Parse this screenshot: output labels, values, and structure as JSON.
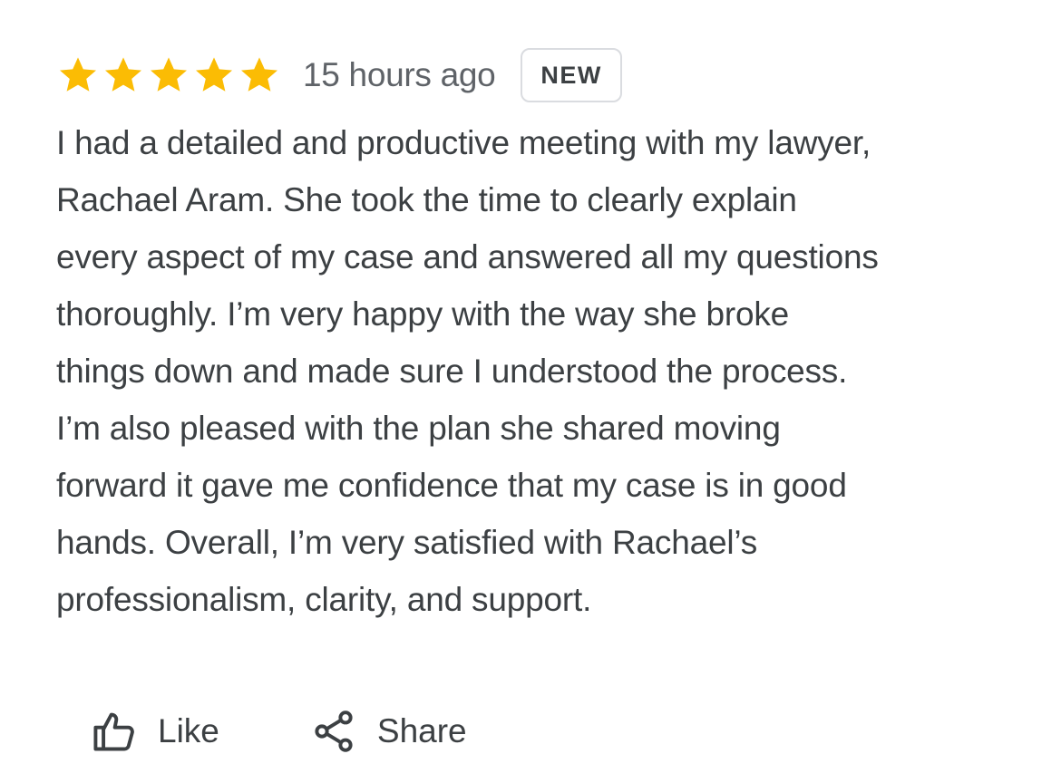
{
  "review": {
    "rating": 5,
    "rating_max": 5,
    "star_color": "#fbbc04",
    "time": "15 hours ago",
    "badge": "NEW",
    "text_lines": [
      "I had a detailed and productive meeting with my lawyer,",
      "Rachael Aram. She took the time to clearly explain",
      "every aspect of my case and answered all my questions",
      "thoroughly. I’m very happy with the way she broke",
      "things down and made sure I understood the process.",
      "I’m also pleased with the plan she shared moving",
      "forward it gave me confidence that my case is in good",
      "hands. Overall, I’m very satisfied with Rachael’s",
      "professionalism, clarity, and support."
    ]
  },
  "actions": {
    "like": {
      "label": "Like",
      "icon": "thumbs-up-icon"
    },
    "share": {
      "label": "Share",
      "icon": "share-icon"
    }
  }
}
